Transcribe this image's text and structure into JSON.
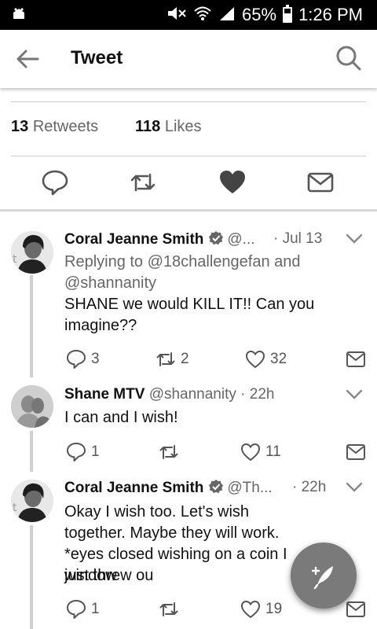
{
  "status_bar": {
    "battery": "65%",
    "time": "1:26 PM"
  },
  "header": {
    "title": "Tweet"
  },
  "stats": {
    "retweets_count": "13",
    "retweets_label": "Retweets",
    "likes_count": "118",
    "likes_label": "Likes"
  },
  "tweets": [
    {
      "name": "Coral Jeanne Smith",
      "handle": "@...",
      "time": "· Jul 13",
      "reply_prefix": "Replying to",
      "reply_to": "@18challengefan and @shannanity",
      "text": "SHANE we would KILL IT!! Can you imagine??",
      "replies": "3",
      "retweets": "2",
      "likes": "32"
    },
    {
      "name": "Shane MTV",
      "handle": "@shannanity",
      "time": "· 22h",
      "text": "I can and I wish!",
      "replies": "1",
      "retweets": "",
      "likes": "11"
    },
    {
      "name": "Coral Jeanne Smith",
      "handle": "@Th...",
      "time": "· 22h",
      "text": "Okay I wish too. Let's wish together. Maybe they will work. *eyes closed wishing on a coin I just threw ou",
      "text_line4": "window",
      "replies": "1",
      "retweets": "",
      "likes": "19"
    }
  ],
  "icons": {
    "back": "arrow-left-icon",
    "search": "search-icon",
    "reply": "reply-icon",
    "retweet": "retweet-icon",
    "like": "heart-icon",
    "dm": "mail-icon",
    "compose": "compose-feather-icon",
    "verified": "verified-badge-icon"
  },
  "colors": {
    "text": "#111111",
    "muted": "#666666",
    "divider": "#cfcfcf",
    "fab": "#7a7a7a"
  }
}
